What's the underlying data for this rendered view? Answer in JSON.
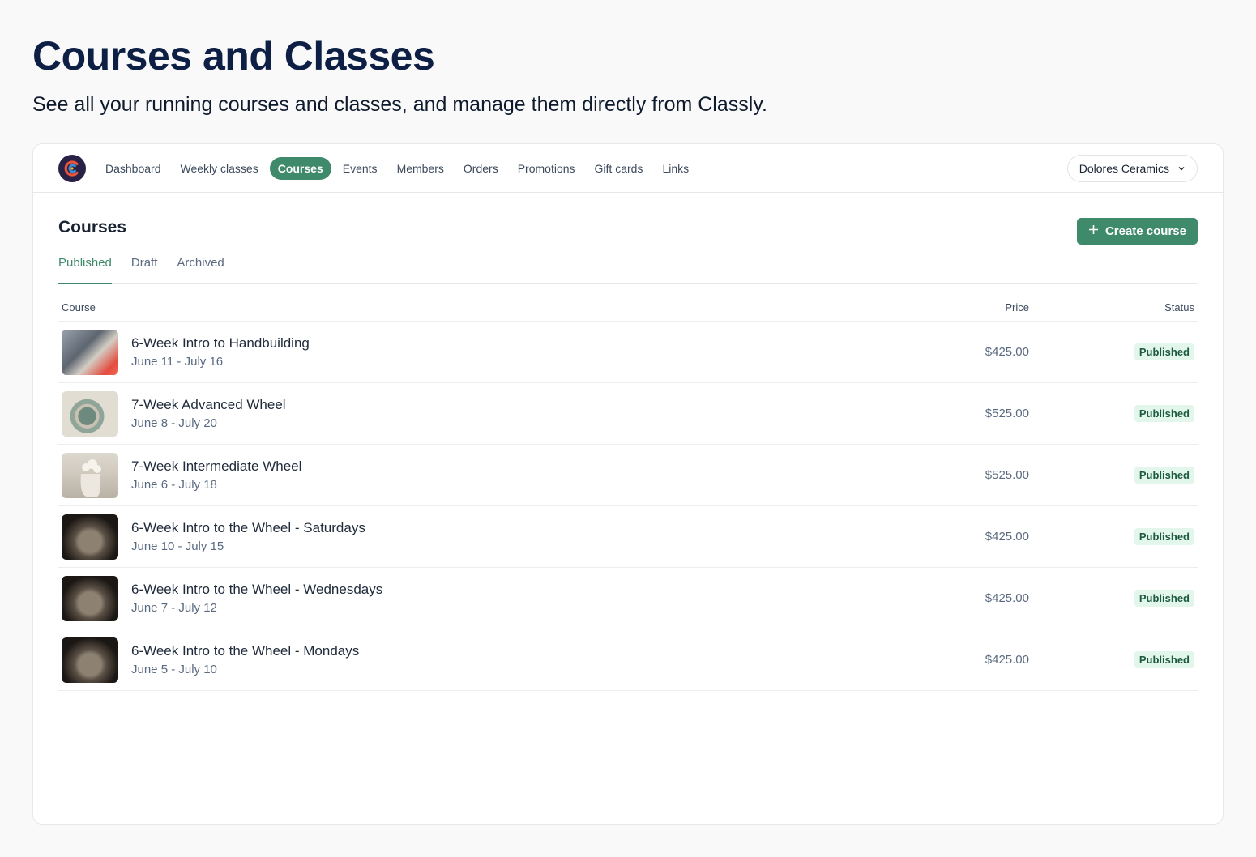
{
  "hero": {
    "title": "Courses and Classes",
    "subtitle": "See all your running courses and classes, and manage them directly from Classly."
  },
  "nav": {
    "items": [
      {
        "label": "Dashboard",
        "active": false
      },
      {
        "label": "Weekly classes",
        "active": false
      },
      {
        "label": "Courses",
        "active": true
      },
      {
        "label": "Events",
        "active": false
      },
      {
        "label": "Members",
        "active": false
      },
      {
        "label": "Orders",
        "active": false
      },
      {
        "label": "Promotions",
        "active": false
      },
      {
        "label": "Gift cards",
        "active": false
      },
      {
        "label": "Links",
        "active": false
      }
    ],
    "org": "Dolores Ceramics"
  },
  "section": {
    "title": "Courses",
    "create_label": "Create course",
    "tabs": [
      {
        "label": "Published",
        "active": true
      },
      {
        "label": "Draft",
        "active": false
      },
      {
        "label": "Archived",
        "active": false
      }
    ]
  },
  "table": {
    "headers": {
      "course": "Course",
      "price": "Price",
      "status": "Status"
    },
    "rows": [
      {
        "name": "6-Week Intro to Handbuilding",
        "dates": "June 11 - July 16",
        "price": "$425.00",
        "status": "Published"
      },
      {
        "name": "7-Week Advanced Wheel",
        "dates": "June 8 - July 20",
        "price": "$525.00",
        "status": "Published"
      },
      {
        "name": "7-Week Intermediate Wheel",
        "dates": "June 6 - July 18",
        "price": "$525.00",
        "status": "Published"
      },
      {
        "name": "6-Week Intro to the Wheel - Saturdays",
        "dates": "June 10 - July 15",
        "price": "$425.00",
        "status": "Published"
      },
      {
        "name": "6-Week Intro to the Wheel - Wednesdays",
        "dates": "June 7 - July 12",
        "price": "$425.00",
        "status": "Published"
      },
      {
        "name": "6-Week Intro to the Wheel - Mondays",
        "dates": "June 5 - July 10",
        "price": "$425.00",
        "status": "Published"
      }
    ]
  },
  "colors": {
    "accent": "#3f8a6a",
    "title": "#0d1f44",
    "badge_bg": "#e2f6ec",
    "badge_text": "#1d5a40"
  }
}
